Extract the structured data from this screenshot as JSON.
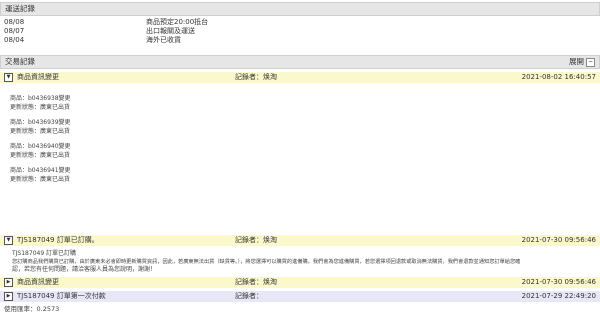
{
  "shipping": {
    "header": "運送記錄",
    "rows": [
      {
        "date": "08/08",
        "status": "商品預定20:00抵台"
      },
      {
        "date": "08/07",
        "status": "出口報關及運送"
      },
      {
        "date": "08/04",
        "status": "海外已收貨"
      }
    ]
  },
  "transactions": {
    "header": "交易記錄",
    "expand_label": "展開",
    "expand_icon": "minus-icon",
    "entries": [
      {
        "title": "商品資訊變更",
        "recorder": "記錄者：焕淘",
        "time": "2021-08-02 16:40:57",
        "color": "#fbf9cb",
        "expanded": true,
        "items": [
          {
            "product": "商品：b0436938變更",
            "update": "更新狀態：廣東已出貨"
          },
          {
            "product": "商品：b0436939變更",
            "update": "更新狀態：廣東已出貨"
          },
          {
            "product": "商品：b0436940變更",
            "update": "更新狀態：廣東已出貨"
          },
          {
            "product": "商品：b0436941變更",
            "update": "更新狀態：廣東已出貨"
          }
        ]
      },
      {
        "title": "TJS187049 訂單已訂購。",
        "recorder": "記錄者：焕淘",
        "time": "2021-07-30 09:56:46",
        "color": "#fbf9cb",
        "expanded": true,
        "lines": [
          "TJS187049 訂單已訂購",
          "您訂購商品我們購買已訂購，由於廣東未必會即時更新購買資訊，因此，若廣東無法出貨（缺貨等。），將您選擇可以購買的進備購，我們會為您進備購買，若您選擇項回退款或取消無法購貨，我們會退款並通知您訂單給您確",
          "認，若您有任何問題，請洽客服人員為您說明，謝謝！"
        ]
      },
      {
        "title": "商品資訊變更",
        "recorder": "記錄者：焕淘",
        "time": "2021-07-30 09:56:46",
        "color": "#fbf9cb",
        "expanded": false
      },
      {
        "title": "TJS187049 訂單第一次付款",
        "recorder": "記錄者：",
        "time": "2021-07-29 22:49:20",
        "color": "#e7e7f7",
        "expanded": false
      }
    ]
  },
  "footer": {
    "usage": "使用匯率：0.2573"
  }
}
